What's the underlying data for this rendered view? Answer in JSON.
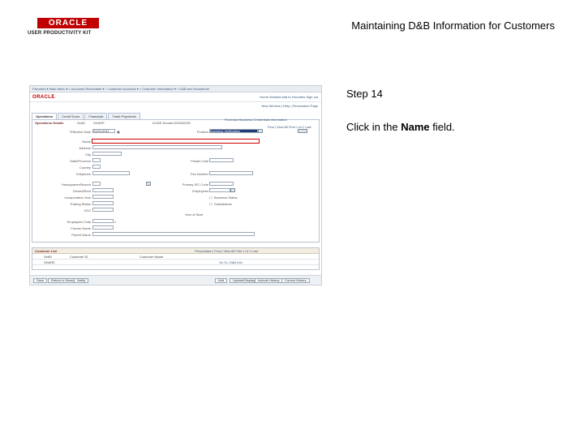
{
  "slide": {
    "logo_brand": "ORACLE",
    "logo_sub": "USER PRODUCTIVITY KIT",
    "title": "Maintaining D&B Information for Customers",
    "step": "Step 14",
    "instruction_prefix": "Click in the ",
    "instruction_field": "Name",
    "instruction_suffix": " field."
  },
  "app": {
    "nav": "Favorites ▾  Main Menu ▾  > Accounts Receivable ▾ > Customer Accounts ▾ > Customer Information ▾ > D&B and Household",
    "brand": "ORACLE",
    "toplinks": "Home   Worklist   Add to Favorites   Sign out",
    "toolbar_right": "New Window | Help | Personalize Page",
    "tabs": [
      "Operations",
      "Credit Score",
      "Financials",
      "Trade Payments"
    ],
    "section_title": "Operations Details",
    "setid_label": "SetID",
    "setid_value": "SHARE",
    "dunsnum_label": "DUNS Number",
    "dunsnum_value": "000000000",
    "purchase_label": "Purchase Business Credentials Information",
    "find_nav": "Find | View All   First 1 of 1 Last",
    "effdate_label": "*Effective Date",
    "effdate_value": "01/01/2011",
    "position_label": "Position",
    "position_value": "Business Verification",
    "name_label": "Name",
    "address_label": "Address",
    "city_label": "City",
    "state_label": "State/Province",
    "postal_label": "Postal Code",
    "country_label": "Country",
    "telephone_label": "Telephone",
    "fax_label": "Fax Number",
    "hq_label": "Headquarter/Branch",
    "primary_sic_label": "Primary SIC Code",
    "owned_label": "Owned/Rent",
    "employees_label": "Employees",
    "inc_year_label": "Incorporation Year",
    "status_label": "Business Status",
    "trading_label": "Trading Status",
    "subs_label": "Subsidiaries",
    "ceo_label": "CEO",
    "first_label": "Year of Start",
    "employees_total_label": "Employees Total",
    "former_label": "Former Name",
    "parent_label": "Parent Name",
    "grid_title": "Customer List",
    "grid_nav": "Personalize | Find | View All   First 1 of 1 Last",
    "grid_cols": [
      "SetID",
      "Customer ID",
      "Customer Name"
    ],
    "grid_row": [
      "SHARE",
      "",
      "Go To: D&B Info"
    ],
    "buttons": [
      "Save",
      "Return to Search",
      "Notify",
      "Add",
      "Update/Display",
      "Include History",
      "Correct History"
    ]
  }
}
